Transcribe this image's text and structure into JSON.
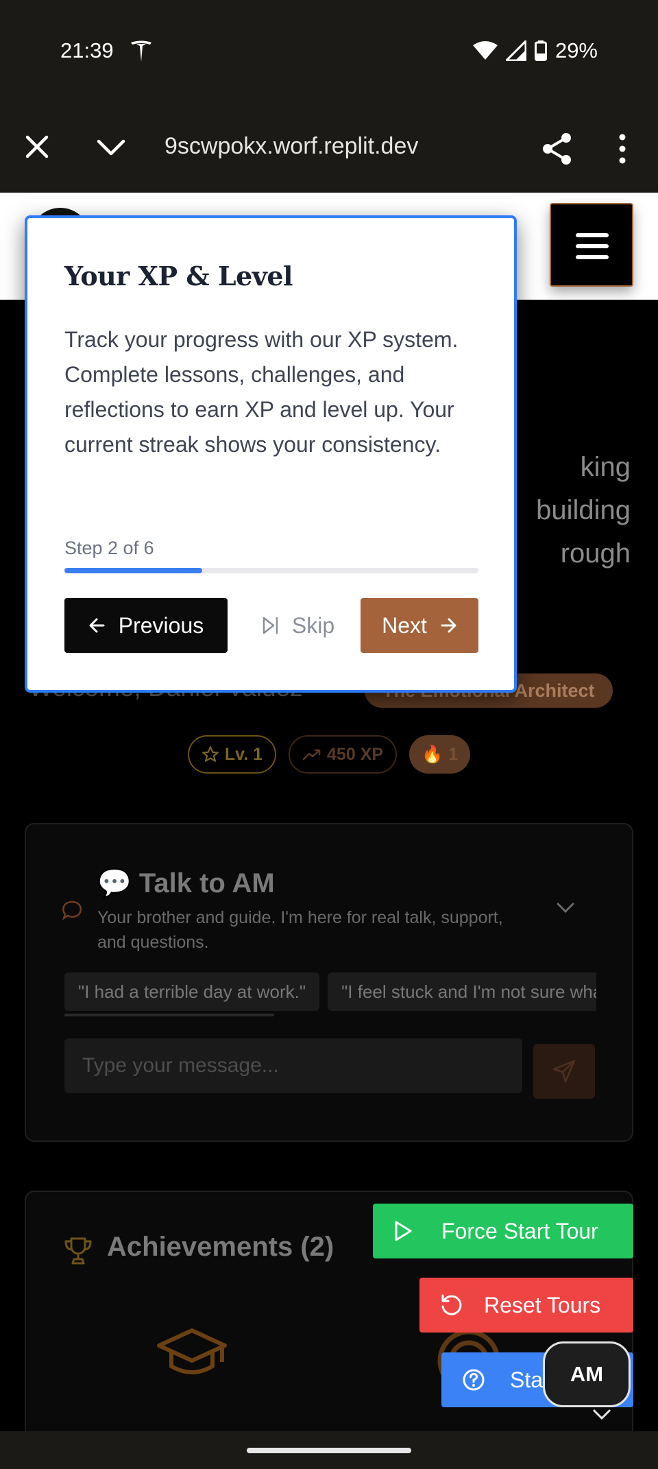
{
  "status_bar": {
    "time": "21:39",
    "battery": "29%"
  },
  "browser": {
    "url": "9scwpokx.worf.replit.dev"
  },
  "hero": {
    "lines": [
      "king",
      "building",
      "rough"
    ]
  },
  "welcome": {
    "text": "Welcome, Daniel Valdez",
    "archetype": "The Emotional Architect"
  },
  "stats": {
    "level": "Lv. 1",
    "xp": "450 XP",
    "streak": "1"
  },
  "chat": {
    "title": "💬 Talk to AM",
    "subtitle": "Your brother and guide. I'm here for real talk, support, and questions.",
    "suggestions": [
      "\"I had a terrible day at work.\"",
      "\"I feel stuck and I'm not sure what to do.\""
    ],
    "placeholder": "Type your message..."
  },
  "achievements": {
    "title": "Achievements (2)"
  },
  "floating": {
    "force_tour": "Force Start Tour",
    "reset_tours": "Reset Tours",
    "tour_help": "Start Tour",
    "am": "AM"
  },
  "tour": {
    "title": "Your XP & Level",
    "body": "Track your progress with our XP system. Complete lessons, challenges, and reflections to earn XP and level up. Your current streak shows your consistency.",
    "step": "Step 2 of 6",
    "progress": 0.333,
    "previous": "Previous",
    "skip": "Skip",
    "next": "Next"
  },
  "colors": {
    "accent_blue": "#2f7df6",
    "brand_brown": "#a4633b",
    "green": "#22c55e",
    "red": "#ef4444",
    "blue": "#3b82f6"
  },
  "icons": [
    "tesla-icon",
    "wifi-icon",
    "signal-icon",
    "battery-icon",
    "close-icon",
    "chevron-down-icon",
    "share-icon",
    "more-vertical-icon",
    "menu-icon",
    "star-icon",
    "trending-up-icon",
    "flame-icon",
    "chat-bubble-icon",
    "send-icon",
    "trophy-icon",
    "graduation-cap-icon",
    "target-icon",
    "play-icon",
    "rotate-ccw-icon",
    "help-circle-icon",
    "arrow-left-icon",
    "skip-forward-icon",
    "arrow-right-icon"
  ]
}
